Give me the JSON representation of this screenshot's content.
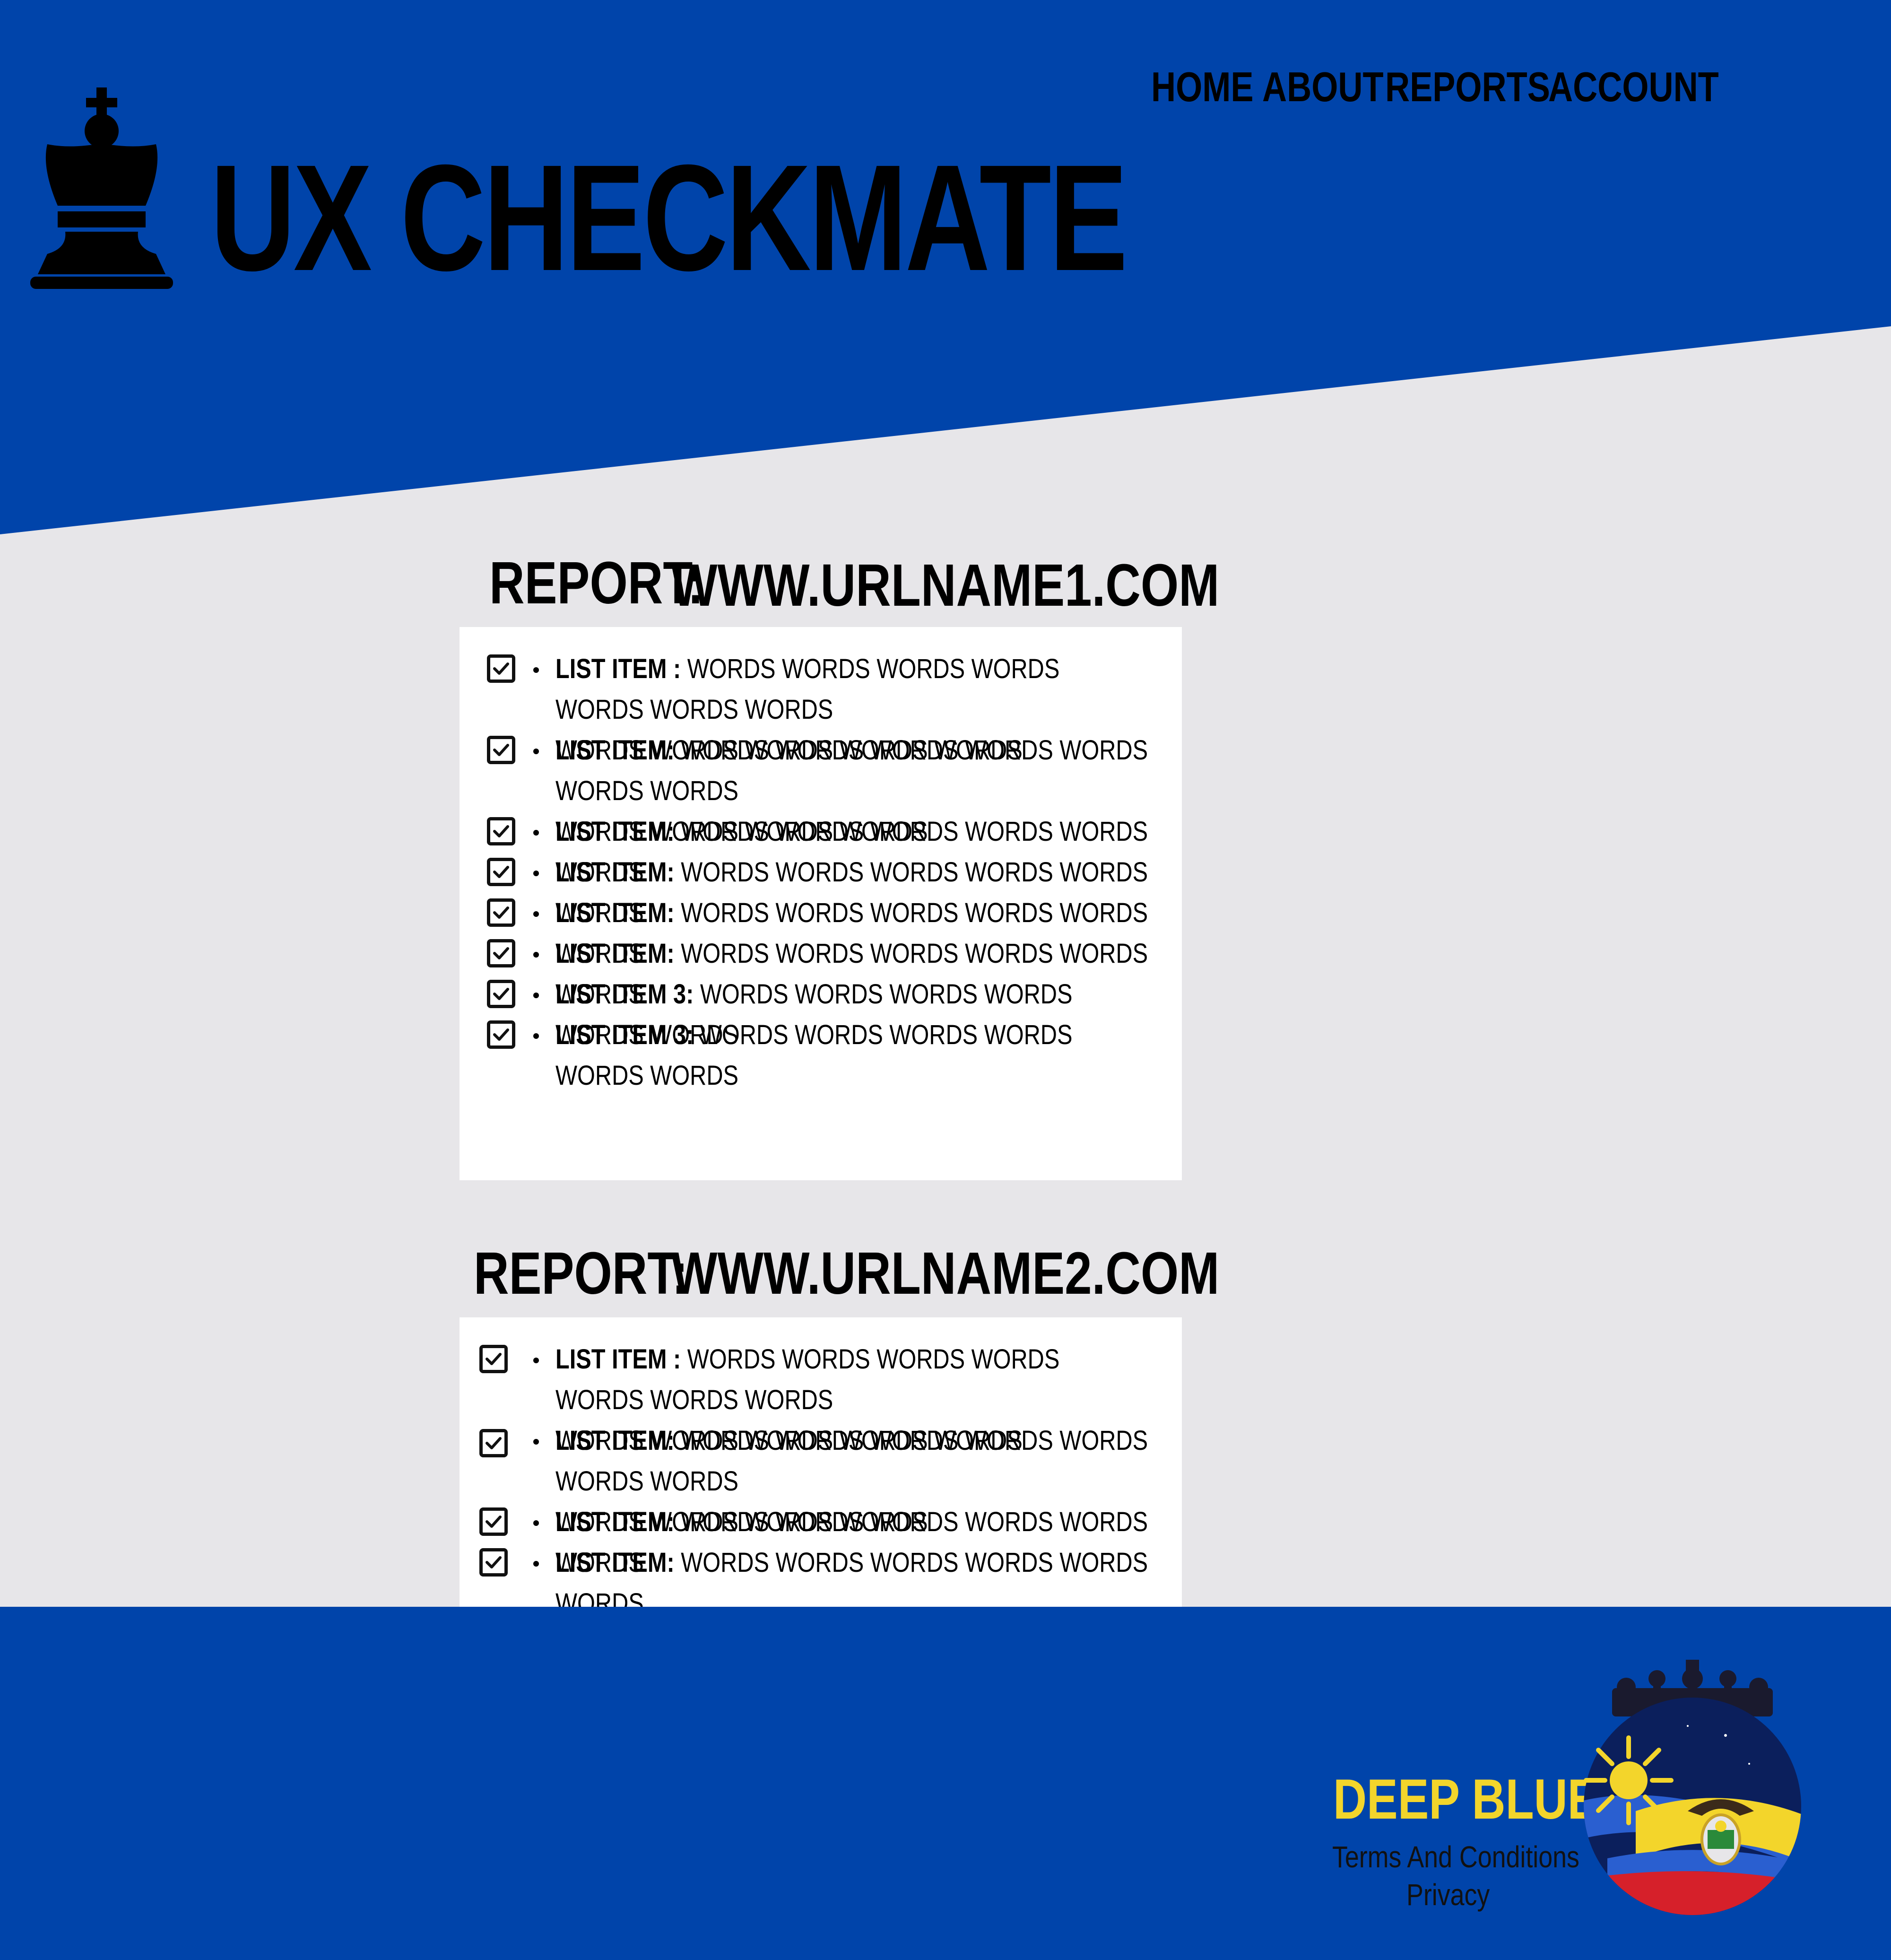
{
  "header": {
    "brand": "UX CHECKMATE",
    "nav": [
      "HOME",
      "ABOUT",
      "REPORTS",
      "ACCOUNT"
    ]
  },
  "reports": [
    {
      "label": "REPORT:",
      "url": "WWW.URLNAME1.COM",
      "items": [
        {
          "key": "LIST ITEM :",
          "text": "WORDS WORDS WORDS WORDS WORDS WORDS WORDS",
          "cont": "WORDS WORDS WORDS WORDS WORDS"
        },
        {
          "key": "LIST ITEM:",
          "text": "WORDS WORDS WORDS WORDS WORDS WORDS WORDS",
          "cont": "WORDS WORDS WORDS WORDS"
        },
        {
          "key": "LIST ITEM:",
          "text": "WORDS WORDS WORDS WORDS WORDS WORDS"
        },
        {
          "key": "LIST ITEM:",
          "text": "WORDS WORDS WORDS WORDS WORDS WORDS"
        },
        {
          "key": "LIST ITEM:",
          "text": "WORDS WORDS WORDS WORDS WORDS WORDS"
        },
        {
          "key": "LIST ITEM:",
          "text": "WORDS WORDS WORDS WORDS WORDS WORDS"
        },
        {
          "key": "LIST ITEM 3:",
          "text": "WORDS WORDS WORDS WORDS WORDS WORDS"
        },
        {
          "key": "LIST ITEM 3:",
          "text": "WORDS WORDS WORDS WORDS WORDS WORDS"
        }
      ]
    },
    {
      "label": "REPORT:",
      "url": "WWW.URLNAME2.COM",
      "items": [
        {
          "key": "LIST ITEM :",
          "text": "WORDS WORDS WORDS WORDS WORDS WORDS WORDS",
          "cont": "WORDS WORDS WORDS WORDS WORDS"
        },
        {
          "key": "LIST ITEM:",
          "text": "WORDS WORDS WORDS WORDS WORDS WORDS WORDS",
          "cont": "WORDS WORDS WORDS WORDS"
        },
        {
          "key": "LIST ITEM:",
          "text": "WORDS WORDS WORDS WORDS WORDS WORDS"
        },
        {
          "key": "LIST ITEM:",
          "text": "WORDS WORDS WORDS WORDS WORDS WORDS"
        }
      ]
    }
  ],
  "footer": {
    "brand": "DEEP BLUE",
    "links": [
      "Terms And Conditions",
      "Privacy"
    ]
  },
  "icons": {
    "logo": "chess-king-icon",
    "checkbox": "checked-checkbox-icon",
    "emblem": "deep-blue-emblem"
  },
  "colors": {
    "primary_blue": "#0044aa",
    "background": "#e7e6e9",
    "card": "#ffffff",
    "footer_brand": "#f3d52b"
  }
}
